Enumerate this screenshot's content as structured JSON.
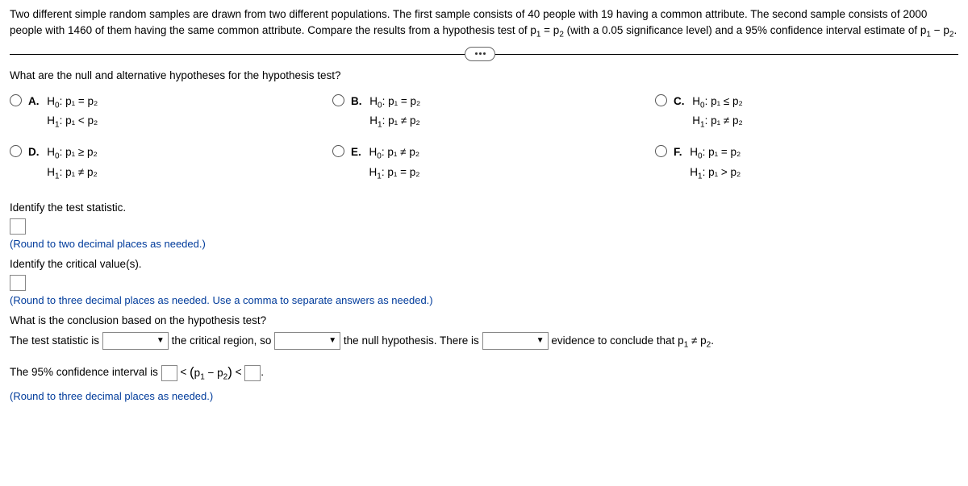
{
  "problem": {
    "text_a": "Two different simple random samples are drawn from two different populations. The first sample consists of 40 people with 19 having a common attribute. The second sample consists of 2000 people with 1460 of them having the same common attribute. Compare the results from a hypothesis test of p",
    "text_b": " = p",
    "text_c": " (with a 0.05 significance level) and a 95% confidence interval estimate of p",
    "text_d": " − p",
    "text_e": "."
  },
  "more_label": "...",
  "q1": "What are the null and alternative hypotheses for the hypothesis test?",
  "choices": {
    "A": {
      "label": "A.",
      "h0_pre": "H",
      "h0_sub": "0",
      "h0_body": ": p₁ = p₂",
      "h1_pre": "H",
      "h1_sub": "1",
      "h1_body": ": p₁ < p₂"
    },
    "B": {
      "label": "B.",
      "h0_pre": "H",
      "h0_sub": "0",
      "h0_body": ": p₁ = p₂",
      "h1_pre": "H",
      "h1_sub": "1",
      "h1_body": ": p₁ ≠ p₂"
    },
    "C": {
      "label": "C.",
      "h0_pre": "H",
      "h0_sub": "0",
      "h0_body": ": p₁ ≤ p₂",
      "h1_pre": "H",
      "h1_sub": "1",
      "h1_body": ": p₁ ≠ p₂"
    },
    "D": {
      "label": "D.",
      "h0_pre": "H",
      "h0_sub": "0",
      "h0_body": ": p₁ ≥ p₂",
      "h1_pre": "H",
      "h1_sub": "1",
      "h1_body": ": p₁ ≠ p₂"
    },
    "E": {
      "label": "E.",
      "h0_pre": "H",
      "h0_sub": "0",
      "h0_body": ": p₁ ≠ p₂",
      "h1_pre": "H",
      "h1_sub": "1",
      "h1_body": ": p₁ = p₂"
    },
    "F": {
      "label": "F.",
      "h0_pre": "H",
      "h0_sub": "0",
      "h0_body": ": p₁ = p₂",
      "h1_pre": "H",
      "h1_sub": "1",
      "h1_body": ": p₁ > p₂"
    }
  },
  "identify_ts": "Identify the test statistic.",
  "round2": "(Round to two decimal places as needed.)",
  "identify_cv": "Identify the critical value(s).",
  "round3_comma": "(Round to three decimal places as needed. Use a comma to separate answers as needed.)",
  "conclusion_q": "What is the conclusion based on the hypothesis test?",
  "concl": {
    "a": "The test statistic is",
    "b": "the critical region, so",
    "c": "the null hypothesis. There is",
    "d": "evidence to conclude that p",
    "d2": " ≠ p",
    "d3": "."
  },
  "ci": {
    "a": "The 95% confidence interval is ",
    "lt1": " < ",
    "expr_open": "(",
    "expr_p1": "p",
    "expr_minus": " − ",
    "expr_p2": "p",
    "expr_close": ")",
    "lt2": " < "
  },
  "round3": "(Round to three decimal places as needed.)"
}
